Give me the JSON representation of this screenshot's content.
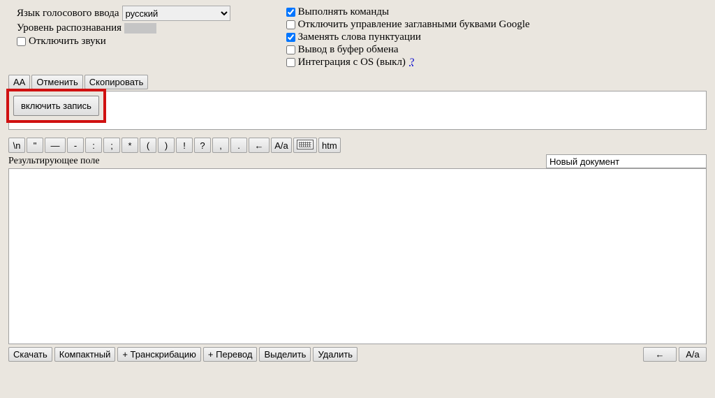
{
  "settings": {
    "lang_label": "Язык голосового ввода",
    "lang_value": "русский",
    "rec_level_label": "Уровень распознавания",
    "mute_label": "Отключить звуки",
    "mute_checked": false
  },
  "options": {
    "o1": {
      "label": "Выполнять команды",
      "checked": true
    },
    "o2": {
      "label": "Отключить управление заглавными буквами Google",
      "checked": false
    },
    "o3": {
      "label": "Заменять слова пунктуации",
      "checked": true
    },
    "o4": {
      "label": "Вывод в буфер обмена",
      "checked": false
    },
    "o5": {
      "label": "Интеграция с OS (выкл)",
      "checked": false
    },
    "help": "?"
  },
  "toolbar1": {
    "aa": "AA",
    "cancel": "Отменить",
    "copy": "Скопировать"
  },
  "record_btn": "включить запись",
  "punct": {
    "b1": "\\n",
    "b2": "\"",
    "b3": "—",
    "b4": "-",
    "b5": ":",
    "b6": ";",
    "b7": "*",
    "b8": "(",
    "b9": ")",
    "b10": "!",
    "b11": "?",
    "b12": ",",
    "b13": ".",
    "b14": "←",
    "b15": "A/a",
    "b16_icon": "keyboard-icon",
    "b17": "htm"
  },
  "result": {
    "label": "Результирующее поле",
    "docname": "Новый документ"
  },
  "bottom": {
    "download": "Скачать",
    "compact": "Компактный",
    "transcribe": "+ Транскрибацию",
    "translate": "+ Перевод",
    "select": "Выделить",
    "delete": "Удалить",
    "arrow": "←",
    "case": "A/a"
  }
}
